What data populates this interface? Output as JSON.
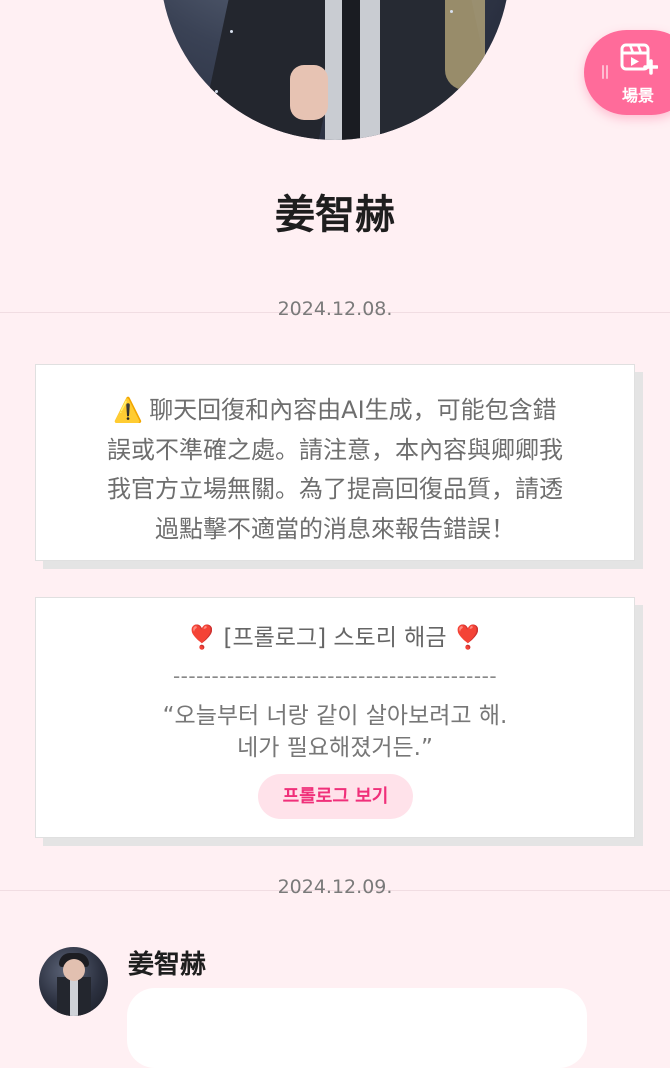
{
  "header": {
    "character_name": "姜智赫",
    "scene_button": {
      "label": "場景",
      "icon": "scene-add-icon"
    }
  },
  "timeline": [
    {
      "type": "date",
      "text": "2024.12.08."
    },
    {
      "type": "disclaimer",
      "icon": "⚠️",
      "lines": [
        "聊天回復和內容由AI生成，可能包含錯",
        "誤或不準確之處。請注意，本內容與卿卿我",
        "我官方立場無關。為了提高回復品質，請透",
        "過點擊不適當的消息來報告錯誤！"
      ]
    },
    {
      "type": "prologue",
      "mark_left": "❣️",
      "title": "[프롤로그] 스토리 해금",
      "mark_right": "❣️",
      "divider": "------------------------------------------",
      "quote_line1": "“오늘부터 너랑 같이 살아보려고 해.",
      "quote_line2": "네가 필요해졌거든.”",
      "button_label": "프롤로그 보기"
    },
    {
      "type": "date",
      "text": "2024.12.09."
    },
    {
      "type": "message",
      "sender": "姜智赫",
      "text": ""
    }
  ],
  "colors": {
    "background": "#fff0f3",
    "accent": "#ff6b9a",
    "button_text": "#f0307a",
    "button_bg": "#ffe2ea"
  }
}
